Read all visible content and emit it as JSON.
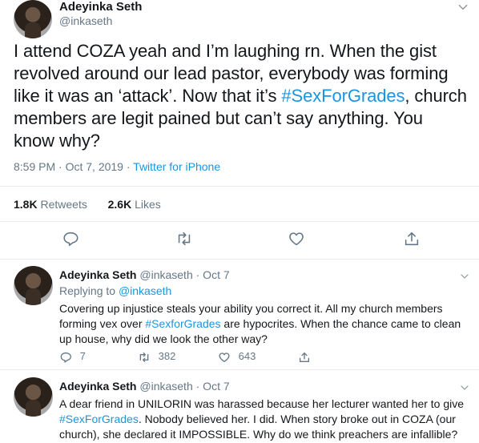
{
  "main_tweet": {
    "display_name": "Adeyinka Seth",
    "handle": "@inkaseth",
    "text_before_hashtag": "I attend COZA yeah and I’m laughing rn. When the gist revolved around our lead pastor, everybody was forming like it was an ‘attack’. Now that it’s ",
    "hashtag": "#SexForGrades",
    "text_after_hashtag": ", church members are legit pained but can’t say anything. You know why?",
    "time": "8:59 PM · Oct 7, 2019",
    "separator": " · ",
    "source": "Twitter for iPhone",
    "retweets_count": "1.8K",
    "retweets_label": "Retweets",
    "likes_count": "2.6K",
    "likes_label": "Likes"
  },
  "replies": [
    {
      "display_name": "Adeyinka Seth",
      "handle": "@inkaseth",
      "date": "· Oct 7",
      "replying_to_label": "Replying to ",
      "replying_to_handle": "@inkaseth",
      "text_1": "Covering up injustice steals your ability you correct it. All my church members forming vex over ",
      "hashtag": "#SexforGrades",
      "text_2": " are hypocrites. When the chance came to clean up house, why did we look the other way?",
      "replies_count": "7",
      "retweets_count": "382",
      "likes_count": "643"
    },
    {
      "display_name": "Adeyinka Seth",
      "handle": "@inkaseth",
      "date": "· Oct 7",
      "text_1": "A dear friend in UNILORIN was harassed because her lecturer wanted her to give ",
      "hashtag": "#SexForGrades",
      "text_2": ". Nobody believed her. I did. When story broke out in COZA (our church), she declared it IMPOSSIBLE. Why do we think preachers are infallible?"
    }
  ],
  "icons": {
    "reply": "reply-icon",
    "retweet": "retweet-icon",
    "like": "heart-icon",
    "share": "share-icon",
    "menu": "chevron-down-icon"
  },
  "colors": {
    "link": "#1b95e0",
    "muted": "#657786",
    "text": "#14171a",
    "divider": "#e6ecf0"
  }
}
